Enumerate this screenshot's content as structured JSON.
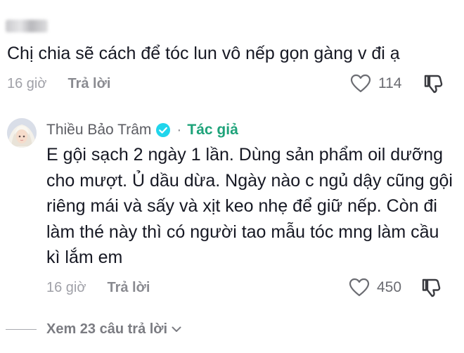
{
  "comment": {
    "username": "",
    "text": "Chị chia sẽ cách để tóc lun vô nếp gọn gàng v đi ạ",
    "time": "16 giờ",
    "reply_label": "Trả lời",
    "likes": "114"
  },
  "reply": {
    "name": "Thiều Bảo Trâm",
    "dot": "·",
    "author_badge": "Tác giả",
    "text": "E gội sạch 2 ngày 1 lần. Dùng sản phẩm oil dưỡng cho mượt. Ủ dầu dừa. Ngày nào c ngủ dậy cũng gội riêng mái và sấy và xịt keo nhẹ để giữ nếp. Còn đi làm thé này thì có người tao mẫu tóc mng làm cầu kì lắm em",
    "time": "16 giờ",
    "reply_label": "Trả lời",
    "likes": "450"
  },
  "view_more": {
    "label": "Xem 23 câu trả lời"
  },
  "icons": {
    "like": "heart-outline-icon",
    "dislike": "thumbs-down-icon",
    "verified": "verified-check-icon",
    "chevron": "chevron-down-icon"
  },
  "colors": {
    "text": "#161823",
    "muted": "#a0a1a8",
    "author": "#1fa37a",
    "verified": "#20d5ec"
  }
}
